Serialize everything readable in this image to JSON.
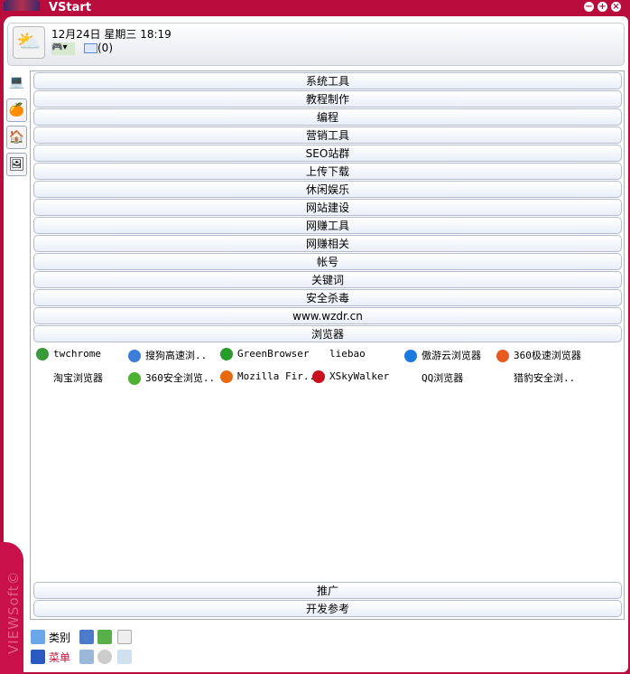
{
  "window": {
    "title": "VStart"
  },
  "header": {
    "date": "12月24日",
    "weekday": "星期三",
    "time": "18:19",
    "mail_count": "(0)"
  },
  "categories_top": [
    "系统工具",
    "教程制作",
    "编程",
    "营销工具",
    "SEO站群",
    "上传下载",
    "休闲娱乐",
    "网站建设",
    "网赚工具",
    "网赚相关",
    "帐号",
    "关键词",
    "安全杀毒",
    "www.wzdr.cn",
    "浏览器"
  ],
  "browsers": [
    {
      "label": "twchrome",
      "icon": "chrome-icon",
      "color": "#3a9a3a"
    },
    {
      "label": "搜狗高速浏..",
      "icon": "sogou-icon",
      "color": "#3b7dd8"
    },
    {
      "label": "GreenBrowser",
      "icon": "greenbrowser-icon",
      "color": "#2a9a2a"
    },
    {
      "label": "liebao",
      "icon": "",
      "color": ""
    },
    {
      "label": "傲游云浏览器",
      "icon": "maxthon-icon",
      "color": "#1a7ae0"
    },
    {
      "label": "360极速浏览器",
      "icon": "360-chrome-icon",
      "color": "#e85a20"
    },
    {
      "label": "淘宝浏览器",
      "icon": "",
      "color": ""
    },
    {
      "label": "360安全浏览..",
      "icon": "360-se-icon",
      "color": "#4cb030"
    },
    {
      "label": "Mozilla Fir..",
      "icon": "firefox-icon",
      "color": "#e86a10"
    },
    {
      "label": "XSkyWalker",
      "icon": "xskywalker-icon",
      "color": "#c81020"
    },
    {
      "label": "QQ浏览器",
      "icon": "",
      "color": ""
    },
    {
      "label": "猎豹安全浏..",
      "icon": "",
      "color": ""
    }
  ],
  "categories_bottom": [
    "推广",
    "开发参考"
  ],
  "toolbar": {
    "category_label": "类别",
    "menu_label": "菜单"
  },
  "brand": {
    "side_text": "VIEWSoft©"
  },
  "colors": {
    "frame": "#b80c3c",
    "menu_text": "#c0103c"
  }
}
